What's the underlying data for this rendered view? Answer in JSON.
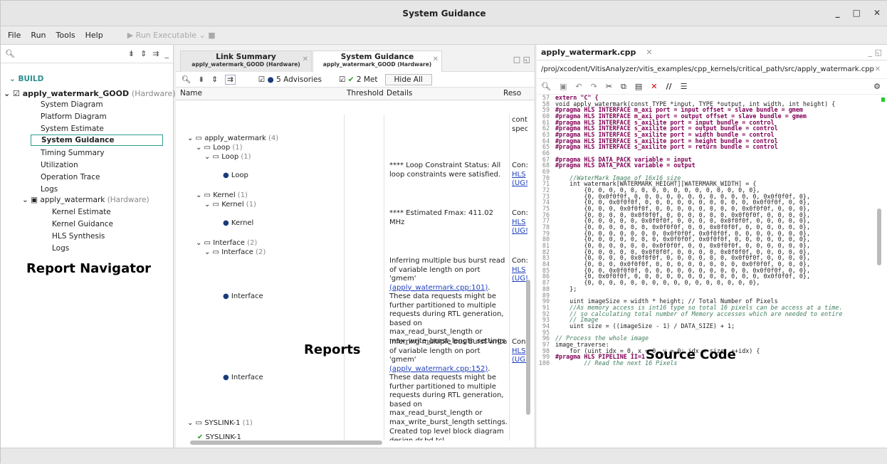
{
  "window": {
    "title": "System Guidance",
    "controls": [
      "_",
      "□",
      "✕"
    ]
  },
  "menu": {
    "file": "File",
    "run": "Run",
    "tools": "Tools",
    "help": "Help",
    "run_exec": "Run Executable"
  },
  "navigator": {
    "section": "BUILD",
    "project": "apply_watermark_GOOD",
    "project_tag": "(Hardware)",
    "items": [
      "System Diagram",
      "Platform Diagram",
      "System Estimate",
      "System Guidance",
      "Timing Summary",
      "Utilization",
      "Operation Trace",
      "Logs"
    ],
    "kernel": "apply_watermark",
    "kernel_tag": "(Hardware)",
    "kernel_items": [
      "Kernel Estimate",
      "Kernel Guidance",
      "HLS Synthesis",
      "Logs"
    ],
    "annotation": "Report Navigator"
  },
  "reports": {
    "tabs": [
      {
        "title": "Link Summary",
        "subtitle": "apply_watermark_GOOD (Hardware)"
      },
      {
        "title": "System Guidance",
        "subtitle": "apply_watermark_GOOD (Hardware)"
      }
    ],
    "advisories": "5 Advisories",
    "met": "2 Met",
    "hide_all": "Hide All",
    "columns": [
      "Name",
      "Threshold",
      "Details",
      "Reso"
    ],
    "annotation": "Reports",
    "rows": {
      "top_res": "cont spec",
      "group1": "apply_watermark",
      "group1_count": "(4)",
      "loop1": "Loop",
      "loop1_count": "(1)",
      "loop2": "Loop",
      "loop2_count": "(1)",
      "loop_item": "Loop",
      "loop_detail": "**** Loop Constraint Status: All loop constraints were satisfied.",
      "res_a": "Con:",
      "res_b": "HLS",
      "res_c": "(UG!",
      "kernel1": "Kernel",
      "kernel1_count": "(1)",
      "kernel2": "Kernel",
      "kernel2_count": "(1)",
      "kernel_item": "Kernel",
      "kernel_detail": "**** Estimated Fmax: 411.02 MHz",
      "iface1": "Interface",
      "iface1_count": "(2)",
      "iface2": "Interface",
      "iface2_count": "(2)",
      "iface_item": "Interface",
      "iface_detail1_a": "Inferring multiple bus burst read of variable length on port 'gmem'",
      "iface_detail1_link": "(apply_watermark.cpp:101)",
      "iface_detail2_a": "Inferring multiple bus burst write of variable length on port 'gmem'",
      "iface_detail2_link": "(apply_watermark.cpp:152)",
      "iface_detail_b": "These data requests might be further partitioned to multiple requests during RTL generation, based on max_read_burst_length or max_write_burst_length settings.",
      "syslink": "SYSLINK-1",
      "syslink_count": "(1)",
      "syslink_item": "SYSLINK-1",
      "syslink_detail": "Created top level block diagram design dr.bd.tcl"
    }
  },
  "editor": {
    "tab": "apply_watermark.cpp",
    "path": "/proj/xcodent/VitisAnalyzer/vitis_examples/cpp_kernels/critical_path/src/apply_watermark.cpp",
    "annotation": "Source Code",
    "lines": [
      {
        "n": "57",
        "t": "extern \"C\" {",
        "c": "kw"
      },
      {
        "n": "58",
        "t": "void apply_watermark(const TYPE *input, TYPE *output, int width, int height) {",
        "c": ""
      },
      {
        "n": "59",
        "t": "#pragma HLS INTERFACE m_axi port = input offset = slave bundle = gmem",
        "c": "pr"
      },
      {
        "n": "60",
        "t": "#pragma HLS INTERFACE m_axi port = output offset = slave bundle = gmem",
        "c": "pr"
      },
      {
        "n": "61",
        "t": "#pragma HLS INTERFACE s_axilite port = input bundle = control",
        "c": "pr"
      },
      {
        "n": "62",
        "t": "#pragma HLS INTERFACE s_axilite port = output bundle = control",
        "c": "pr"
      },
      {
        "n": "63",
        "t": "#pragma HLS INTERFACE s_axilite port = width bundle = control",
        "c": "pr"
      },
      {
        "n": "64",
        "t": "#pragma HLS INTERFACE s_axilite port = height bundle = control",
        "c": "pr"
      },
      {
        "n": "65",
        "t": "#pragma HLS INTERFACE s_axilite port = return bundle = control",
        "c": "pr"
      },
      {
        "n": "66",
        "t": "",
        "c": ""
      },
      {
        "n": "67",
        "t": "#pragma HLS DATA_PACK variable = input",
        "c": "pr"
      },
      {
        "n": "68",
        "t": "#pragma HLS DATA_PACK variable = output",
        "c": "pr"
      },
      {
        "n": "69",
        "t": "",
        "c": ""
      },
      {
        "n": "70",
        "t": "    //WaterMark Image of 16x16 size",
        "c": "cm"
      },
      {
        "n": "71",
        "t": "    int watermark[WATERMARK_HEIGHT][WATERMARK_WIDTH] = {",
        "c": ""
      },
      {
        "n": "72",
        "t": "        {0, 0, 0, 0, 0, 0, 0, 0, 0, 0, 0, 0, 0, 0, 0, 0},",
        "c": ""
      },
      {
        "n": "73",
        "t": "        {0, 0x0f0f0f, 0, 0, 0, 0, 0, 0, 0, 0, 0, 0, 0, 0, 0x0f0f0f, 0},",
        "c": ""
      },
      {
        "n": "74",
        "t": "        {0, 0, 0x0f0f0f, 0, 0, 0, 0, 0, 0, 0, 0, 0, 0, 0x0f0f0f, 0, 0},",
        "c": ""
      },
      {
        "n": "75",
        "t": "        {0, 0, 0, 0x0f0f0f, 0, 0, 0, 0, 0, 0, 0, 0, 0x0f0f0f, 0, 0, 0},",
        "c": ""
      },
      {
        "n": "76",
        "t": "        {0, 0, 0, 0, 0x0f0f0f, 0, 0, 0, 0, 0, 0, 0x0f0f0f, 0, 0, 0, 0},",
        "c": ""
      },
      {
        "n": "77",
        "t": "        {0, 0, 0, 0, 0, 0x0f0f0f, 0, 0, 0, 0, 0x0f0f0f, 0, 0, 0, 0, 0},",
        "c": ""
      },
      {
        "n": "78",
        "t": "        {0, 0, 0, 0, 0, 0, 0x0f0f0f, 0, 0, 0x0f0f0f, 0, 0, 0, 0, 0, 0},",
        "c": ""
      },
      {
        "n": "79",
        "t": "        {0, 0, 0, 0, 0, 0, 0, 0x0f0f0f, 0x0f0f0f, 0, 0, 0, 0, 0, 0, 0},",
        "c": ""
      },
      {
        "n": "80",
        "t": "        {0, 0, 0, 0, 0, 0, 0, 0x0f0f0f, 0x0f0f0f, 0, 0, 0, 0, 0, 0, 0},",
        "c": ""
      },
      {
        "n": "81",
        "t": "        {0, 0, 0, 0, 0, 0, 0x0f0f0f, 0, 0, 0x0f0f0f, 0, 0, 0, 0, 0, 0},",
        "c": ""
      },
      {
        "n": "82",
        "t": "        {0, 0, 0, 0, 0, 0x0f0f0f, 0, 0, 0, 0, 0x0f0f0f, 0, 0, 0, 0, 0},",
        "c": ""
      },
      {
        "n": "83",
        "t": "        {0, 0, 0, 0, 0x0f0f0f, 0, 0, 0, 0, 0, 0, 0x0f0f0f, 0, 0, 0, 0},",
        "c": ""
      },
      {
        "n": "84",
        "t": "        {0, 0, 0, 0x0f0f0f, 0, 0, 0, 0, 0, 0, 0, 0, 0x0f0f0f, 0, 0, 0},",
        "c": ""
      },
      {
        "n": "85",
        "t": "        {0, 0, 0x0f0f0f, 0, 0, 0, 0, 0, 0, 0, 0, 0, 0, 0x0f0f0f, 0, 0},",
        "c": ""
      },
      {
        "n": "86",
        "t": "        {0, 0x0f0f0f, 0, 0, 0, 0, 0, 0, 0, 0, 0, 0, 0, 0, 0x0f0f0f, 0},",
        "c": ""
      },
      {
        "n": "87",
        "t": "        {0, 0, 0, 0, 0, 0, 0, 0, 0, 0, 0, 0, 0, 0, 0, 0},",
        "c": ""
      },
      {
        "n": "88",
        "t": "    };",
        "c": ""
      },
      {
        "n": "89",
        "t": "",
        "c": ""
      },
      {
        "n": "90",
        "t": "    uint imageSize = width * height; // Total Number of Pixels",
        "c": "mix1"
      },
      {
        "n": "91",
        "t": "    //As memory access is int16 type so total 16 pixels can be access at a time.",
        "c": "cm"
      },
      {
        "n": "92",
        "t": "    // so calculating total number of Memory accesses which are needed to entire",
        "c": "cm"
      },
      {
        "n": "93",
        "t": "    // Image",
        "c": "cm"
      },
      {
        "n": "94",
        "t": "    uint size = ((imageSize - 1) / DATA_SIZE) + 1;",
        "c": ""
      },
      {
        "n": "95",
        "t": "",
        "c": ""
      },
      {
        "n": "96",
        "t": "// Process the whole image",
        "c": "cm"
      },
      {
        "n": "97",
        "t": "image_traverse:",
        "c": "lbl"
      },
      {
        "n": "98",
        "t": "    for (uint idx = 0, x = 0, y = 0; idx < size; ++idx) {",
        "c": ""
      },
      {
        "n": "99",
        "t": "#pragma HLS PIPELINE II=1",
        "c": "pr"
      },
      {
        "n": "100",
        "t": "        // Read the next 16 Pixels",
        "c": "cm"
      }
    ]
  }
}
